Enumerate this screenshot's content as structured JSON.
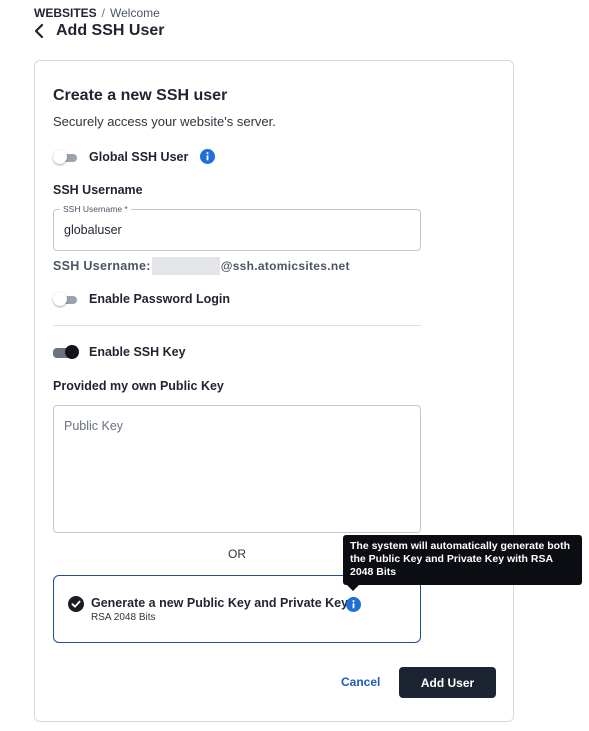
{
  "breadcrumb": {
    "parent": "WEBSITES",
    "separator": "/",
    "current": "Welcome"
  },
  "page": {
    "title": "Add SSH User"
  },
  "card": {
    "title": "Create a new SSH user",
    "subtitle": "Securely access your website's server."
  },
  "toggles": {
    "global_ssh_user": {
      "label": "Global SSH User",
      "on": false
    },
    "enable_password_login": {
      "label": "Enable Password Login",
      "on": false
    },
    "enable_ssh_key": {
      "label": "Enable SSH Key",
      "on": true
    }
  },
  "username": {
    "section_label": "SSH Username",
    "field_label": "SSH Username *",
    "value": "globaluser",
    "preview_prefix": "SSH Username:",
    "preview_host": "@ssh.atomicsites.net"
  },
  "public_key": {
    "section_label": "Provided my own Public Key",
    "placeholder": "Public Key"
  },
  "or_text": "OR",
  "generate": {
    "title": "Generate a new Public Key and Private Key",
    "subtitle": "RSA 2048 Bits",
    "selected": true,
    "tooltip": "The system will automatically generate both the Public Key and Private Key with RSA 2048 Bits"
  },
  "actions": {
    "cancel": "Cancel",
    "submit": "Add User"
  },
  "colors": {
    "accent": "#1d5bbf",
    "primary_button": "#1c2331",
    "info_icon": "#1f6fd6"
  },
  "icons": [
    "chevron-left-icon",
    "info-icon",
    "check-circle-icon"
  ]
}
